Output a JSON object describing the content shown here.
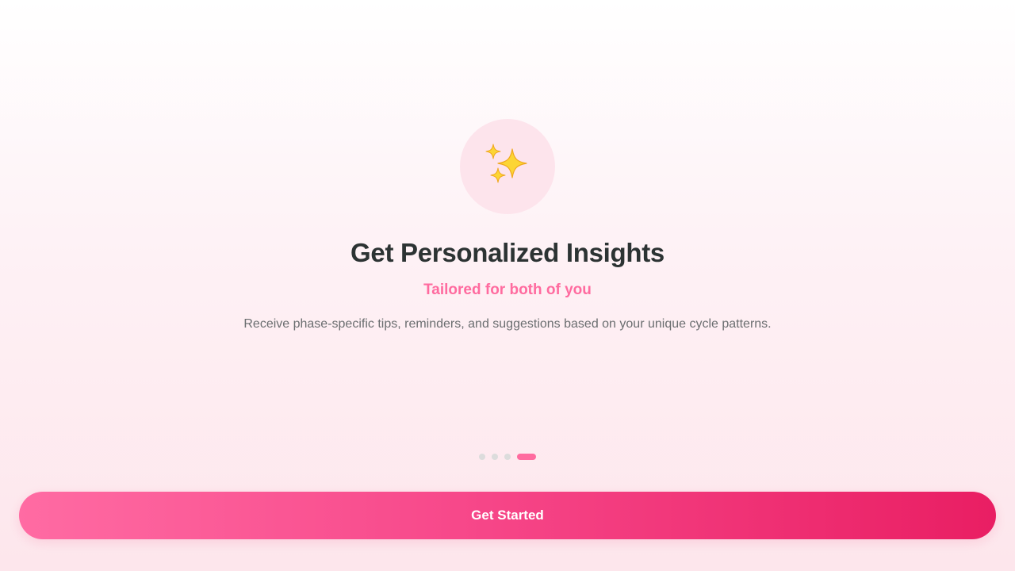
{
  "onboarding": {
    "icon": "sparkles-icon",
    "title": "Get Personalized Insights",
    "subtitle": "Tailored for both of you",
    "description": "Receive phase-specific tips, reminders, and suggestions based on your unique cycle patterns.",
    "pagination": {
      "total_pages": 4,
      "current_page": 4
    },
    "cta_label": "Get Started"
  },
  "colors": {
    "accent": "#ff6b9f",
    "accent_dark": "#e91e63",
    "title": "#2c3333",
    "body_text": "#6b6e70",
    "icon_bg": "#fde4ec",
    "dot_inactive": "#dcdcdc"
  }
}
